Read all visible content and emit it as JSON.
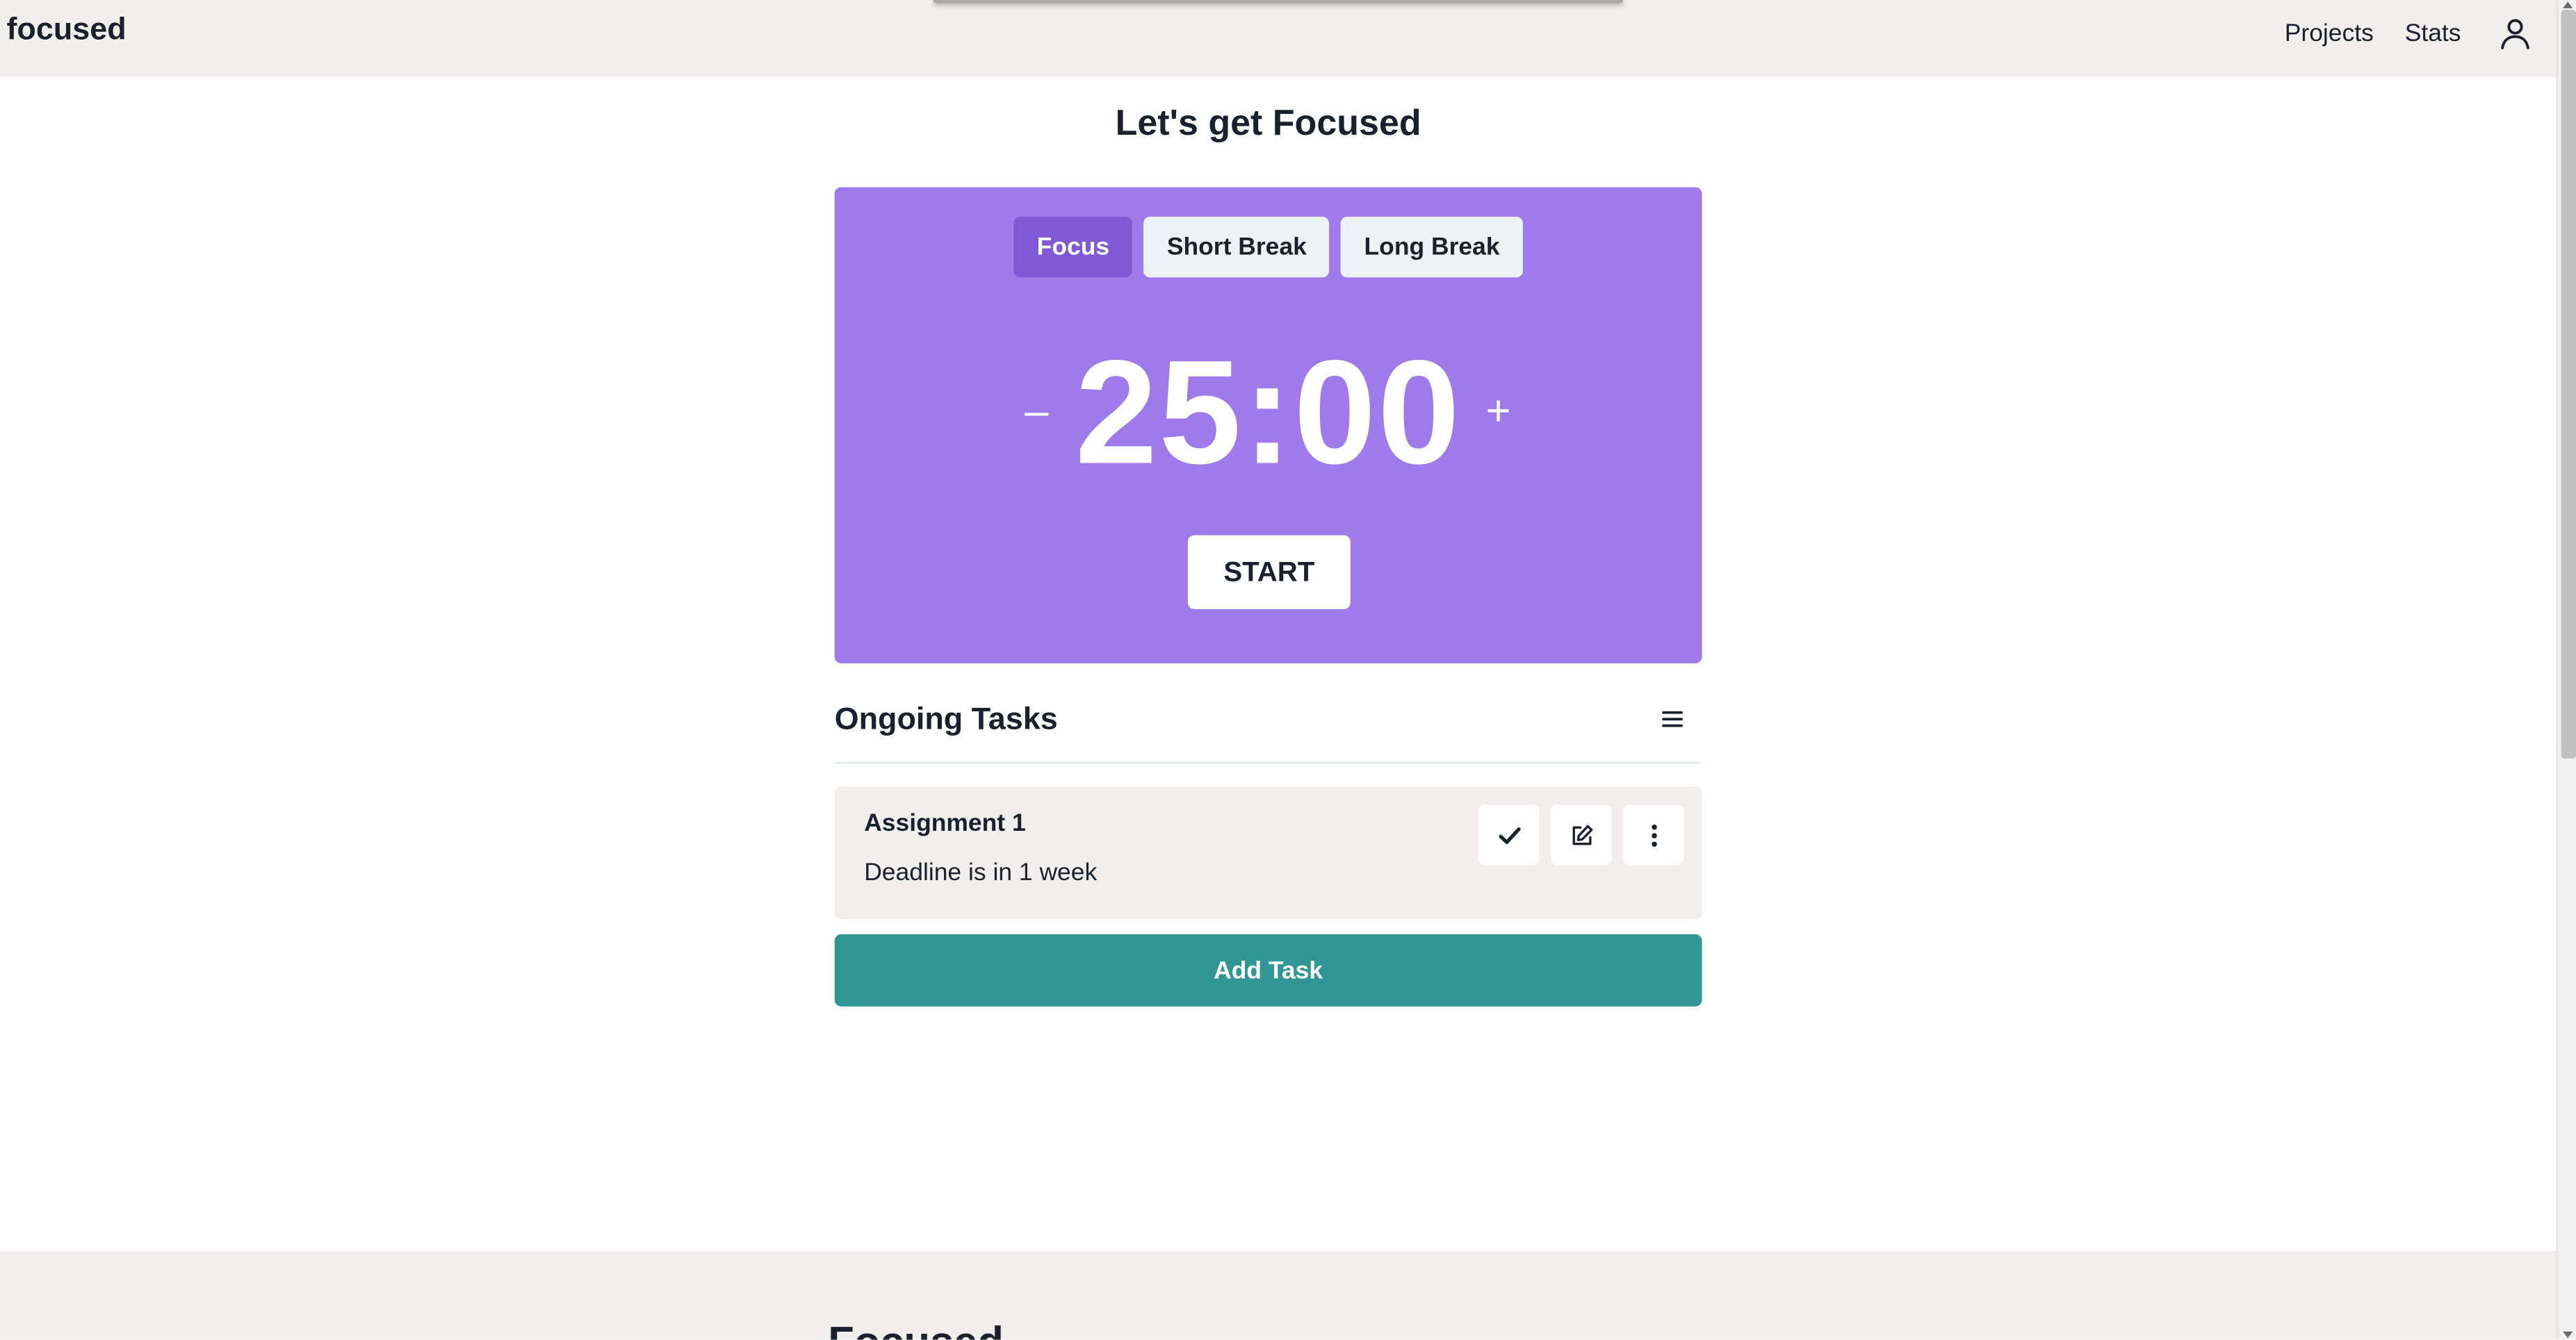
{
  "header": {
    "logo": "focused",
    "nav": {
      "projects": "Projects",
      "stats": "Stats"
    },
    "user_icon": "user-icon"
  },
  "main": {
    "title": "Let's get Focused",
    "timer": {
      "modes": [
        {
          "label": "Focus",
          "active": true
        },
        {
          "label": "Short Break",
          "active": false
        },
        {
          "label": "Long Break",
          "active": false
        }
      ],
      "minus_label": "–",
      "time": "25:00",
      "plus_label": "+",
      "start_label": "START"
    },
    "tasks": {
      "title": "Ongoing Tasks",
      "menu_icon": "hamburger-menu-icon",
      "items": [
        {
          "name": "Assignment 1",
          "description": "Deadline is in 1 week"
        }
      ],
      "add_label": "Add Task"
    }
  },
  "footer": {
    "title": "Focused"
  },
  "colors": {
    "timer_bg": "#9f7aea",
    "active_mode": "#805ad5",
    "add_task": "#319795",
    "header_bg": "#f0efeb"
  }
}
